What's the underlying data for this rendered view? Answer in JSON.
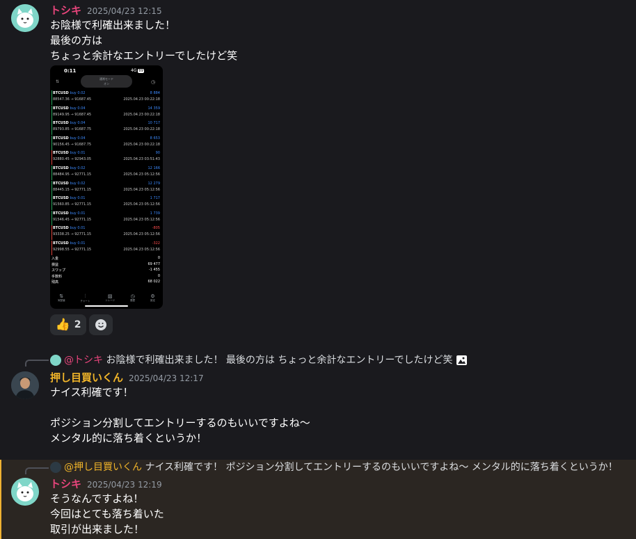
{
  "messages": [
    {
      "author": "トシキ",
      "timestamp": "2025/04/23 12:15",
      "lines": [
        "お陰様で利確出来ました！",
        "最後の方は",
        "ちょっと余計なエントリーでしたけど笑"
      ],
      "reactions": {
        "thumbs_count": "2"
      }
    },
    {
      "reply_author": "@トシキ",
      "reply_text": "お陰様で利確出来ました！ 最後の方は ちょっと余計なエントリーでしたけど笑",
      "author": "押し目買いくん",
      "timestamp": "2025/04/23 12:17",
      "lines": [
        "ナイス利確です！",
        "",
        "ポジション分割してエントリーするのもいいですよね〜",
        "メンタル的に落ち着くというか！"
      ]
    },
    {
      "reply_author": "@押し目買いくん",
      "reply_text": "ナイス利確です！ ポジション分割してエントリーするのもいいですよね〜 メンタル的に落ち着くというか！",
      "author": "トシキ",
      "timestamp": "2025/04/23 12:19",
      "lines": [
        "そうなんですよね！",
        "今回はとても落ち着いた",
        "取引が出来ました！"
      ]
    }
  ],
  "phone": {
    "time": "0:11",
    "signal": "4G",
    "battery": "89",
    "pill_title": "通常モード",
    "pill_sub": "オン",
    "trades": [
      {
        "sym": "BTCUSD",
        "side": "buy 0.02",
        "price": "88547.36 → 91687.45",
        "profit": "8 884",
        "date": "2025.04.23 00:22:18"
      },
      {
        "sym": "BTCUSD",
        "side": "buy 0.04",
        "price": "89149.95 → 91687.45",
        "profit": "14 359",
        "date": "2025.04.23 00:22:18"
      },
      {
        "sym": "BTCUSD",
        "side": "buy 0.04",
        "price": "89793.85 → 91687.75",
        "profit": "10 717",
        "date": "2025.04.23 00:22:18"
      },
      {
        "sym": "BTCUSD",
        "side": "buy 0.04",
        "price": "90156.45 → 91687.75",
        "profit": "8 653",
        "date": "2025.04.23 00:22:18"
      },
      {
        "sym": "BTCUSD",
        "side": "buy 0.01",
        "price": "92880.45 → 92943.05",
        "profit": "90",
        "date": "2025.04.23 03:51:43"
      },
      {
        "sym": "BTCUSD",
        "side": "buy 0.02",
        "price": "88484.95 → 92771.15",
        "profit": "12 166",
        "date": "2025.04.23 05:12:56"
      },
      {
        "sym": "BTCUSD",
        "side": "buy 0.02",
        "price": "88445.15 → 92771.15",
        "profit": "12 279",
        "date": "2025.04.23 05:12:56"
      },
      {
        "sym": "BTCUSD",
        "side": "buy 0.01",
        "price": "91560.85 → 92771.15",
        "profit": "1 717",
        "date": "2025.04.23 05:12:56"
      },
      {
        "sym": "BTCUSD",
        "side": "buy 0.01",
        "price": "91546.45 → 92771.15",
        "profit": "1 739",
        "date": "2025.04.23 05:12:56"
      },
      {
        "sym": "BTCUSD",
        "side": "buy 0.01",
        "price": "93338.25 → 92771.15",
        "profit": "-805",
        "date": "2025.04.23 05:12:56"
      },
      {
        "sym": "BTCUSD",
        "side": "buy 0.01",
        "price": "92998.55 → 92771.15",
        "profit": "-322",
        "date": "2025.04.23 05:12:56"
      }
    ],
    "summary": [
      {
        "label": "入金",
        "value": "0"
      },
      {
        "label": "損益",
        "value": "69 477"
      },
      {
        "label": "スワップ",
        "value": "-1 455"
      },
      {
        "label": "手数料",
        "value": "0"
      },
      {
        "label": "残高",
        "value": "68 022"
      }
    ],
    "nav": [
      "気配値",
      "チャート",
      "トレード",
      "履歴",
      "設定"
    ]
  },
  "colors": {
    "background": "#1a1a1e",
    "pink_name": "#e8457c",
    "gold_name": "#f0b429",
    "highlight_bg": "#2b2622",
    "highlight_border": "#f0b232",
    "profit_blue": "#3d8bff",
    "loss_red": "#ff4d4d"
  }
}
